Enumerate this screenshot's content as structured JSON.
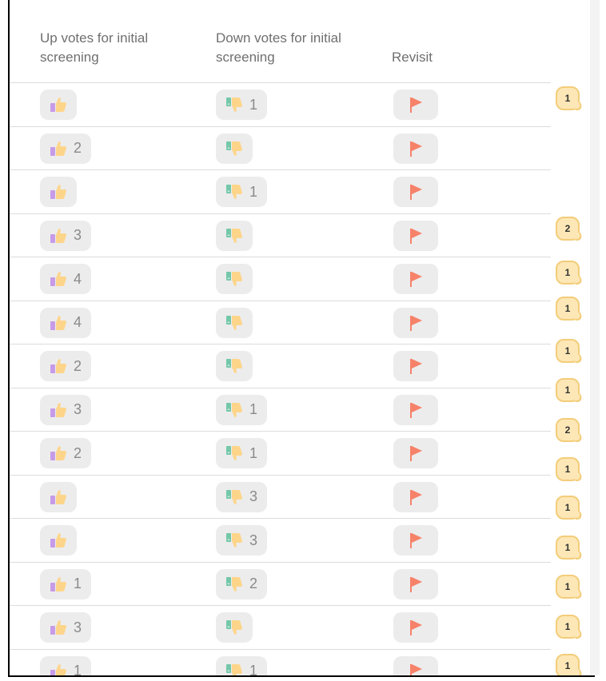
{
  "headers": {
    "upvotes": "Up votes for initial screening",
    "downvotes": "Down votes for initial screening",
    "revisit": "Revisit"
  },
  "icons": {
    "up": "thumbs-up-icon",
    "down": "thumbs-down-icon",
    "flag": "flag-icon",
    "comment": "comment-icon"
  },
  "colors": {
    "flag": "#f7826a",
    "bubble_bg": "#fde7b6",
    "bubble_border": "#f3cd7a",
    "pill_bg": "#ececec"
  },
  "rows": [
    {
      "up": "",
      "down": "1"
    },
    {
      "up": "2",
      "down": ""
    },
    {
      "up": "",
      "down": "1"
    },
    {
      "up": "3",
      "down": ""
    },
    {
      "up": "4",
      "down": ""
    },
    {
      "up": "4",
      "down": ""
    },
    {
      "up": "2",
      "down": ""
    },
    {
      "up": "3",
      "down": "1"
    },
    {
      "up": "2",
      "down": "1"
    },
    {
      "up": "",
      "down": "3"
    },
    {
      "up": "",
      "down": "3"
    },
    {
      "up": "1",
      "down": "2"
    },
    {
      "up": "3",
      "down": ""
    },
    {
      "up": "1",
      "down": "1"
    }
  ],
  "comment_counts": [
    "1",
    "2",
    "1",
    "1",
    "1",
    "1",
    "2",
    "1",
    "1",
    "1",
    "1",
    "1",
    "1"
  ]
}
